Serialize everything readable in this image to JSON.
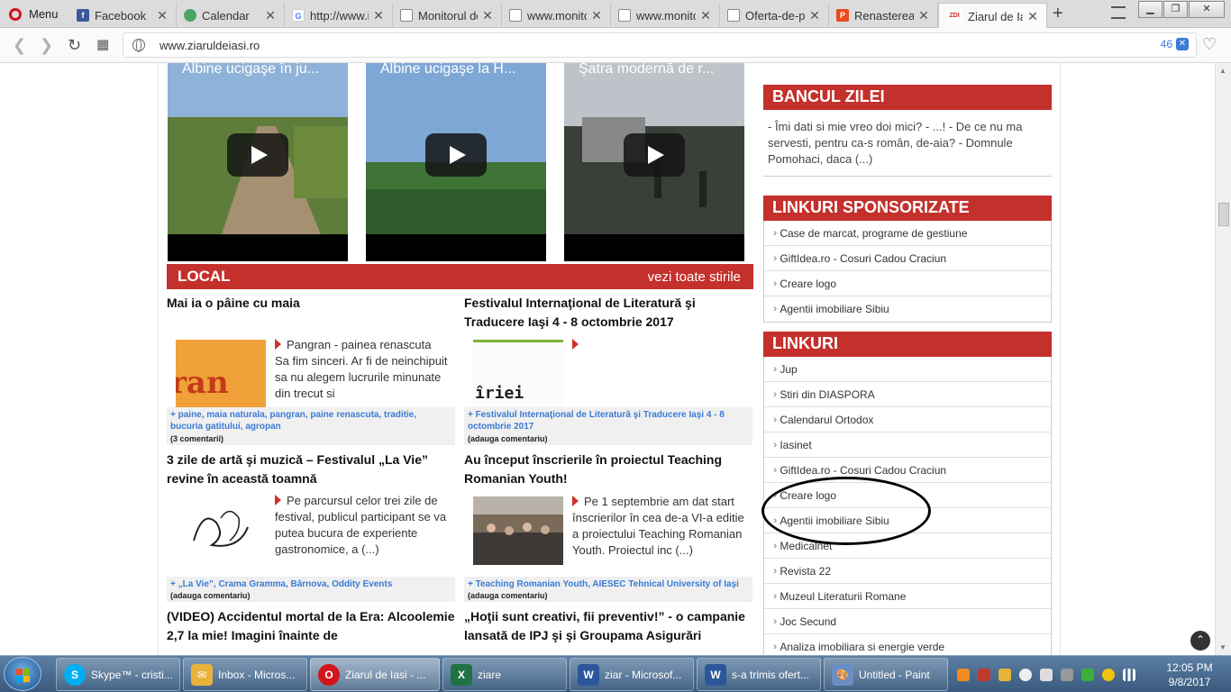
{
  "browser": {
    "menu_label": "Menu",
    "tabs": [
      {
        "label": "Facebook",
        "favicon_color": "#3b5998",
        "favicon_glyph": "f"
      },
      {
        "label": "Calendar",
        "favicon_color": "#4aa564",
        "favicon_glyph": ""
      },
      {
        "label": "http://www.i",
        "favicon_color": "#ffffff",
        "favicon_glyph": "G"
      },
      {
        "label": "Monitorul de",
        "favicon_color": "#9a9a9a",
        "favicon_glyph": ""
      },
      {
        "label": "www.monito",
        "favicon_color": "#9a9a9a",
        "favicon_glyph": ""
      },
      {
        "label": "www.monito",
        "favicon_color": "#9a9a9a",
        "favicon_glyph": ""
      },
      {
        "label": "Oferta-de-p",
        "favicon_color": "#9a9a9a",
        "favicon_glyph": ""
      },
      {
        "label": "Renasterea b",
        "favicon_color": "#e8491d",
        "favicon_glyph": "P"
      },
      {
        "label": "Ziarul de Ias",
        "favicon_color": "#ffffff",
        "favicon_glyph": "ZDI",
        "active": true
      }
    ],
    "new_tab": "+",
    "url": "www.ziaruldeiasi.ro",
    "blocked_count": "46"
  },
  "videos": [
    {
      "title": "Albine ucigaşe în ju..."
    },
    {
      "title": "Albine ucigaşe la H..."
    },
    {
      "title": "Şatra modernă de r..."
    }
  ],
  "local": {
    "title": "LOCAL",
    "more": "vezi toate stirile"
  },
  "articles": [
    {
      "title": "Mai ia o pâine cu maia",
      "excerpt": "Pangran - painea renascuta Sa fim sinceri. Ar fi de neinchipuit sa nu alegem lucrurile minunate din trecut si",
      "tags": "+ paine, maia naturala, pangran, paine renascuta, traditie, bucuria gatitului, agropan",
      "comments": "(3 comentarii)"
    },
    {
      "title": "Festivalul Internaţional de Literatură şi Traducere Iaşi 4 - 8 octombrie 2017",
      "excerpt": "",
      "tags": "+ Festivalul Internaţional de Literatură şi Traducere Iaşi 4 - 8 octombrie 2017",
      "comments": "(adauga comentariu)"
    },
    {
      "title": "3 zile de artă şi muzică – Festivalul „La Vie” revine în această toamnă",
      "excerpt": "Pe parcursul celor trei zile de festival, publicul participant se va putea bucura de experiente gastronomice, a (...)",
      "tags": "+ „La Vie”, Crama Gramma, Bârnova, Oddity Events",
      "comments": "(adauga comentariu)"
    },
    {
      "title": "Au început înscrierile în proiectul Teaching Romanian Youth!",
      "excerpt": "Pe 1 septembrie am dat start înscrierilor în cea de-a VI-a editie a proiectului Teaching Romanian Youth. Proiectul inc (...)",
      "tags": "+ Teaching Romanian Youth, AIESEC Tehnical University of Iaşi",
      "comments": "(adauga comentariu)"
    },
    {
      "title": "(VIDEO) Accidentul mortal de la Era: Alcoolemie 2,7 la mie! Imagini înainte de",
      "excerpt": "",
      "tags": "",
      "comments": ""
    },
    {
      "title": "„Hoţii sunt creativi, fii preventiv!” - o campanie lansată de IPJ şi şi Groupama Asigurări",
      "excerpt": "",
      "tags": "",
      "comments": ""
    }
  ],
  "image_text": {
    "pangran": "ran",
    "festival": "îriei"
  },
  "sidebar": {
    "joke_title": "BANCUL ZILEI",
    "joke_text": "- Îmi dati si mie vreo doi mici? - ...! - De ce nu ma servesti, pentru ca-s român, de-aia? - Domnule Pomohaci, daca (...)",
    "sponsored_title": "LINKURI SPONSORIZATE",
    "sponsored": [
      "Case de marcat, programe de gestiune",
      "GiftIdea.ro - Cosuri Cadou Craciun",
      "Creare logo",
      "Agentii imobiliare Sibiu"
    ],
    "links_title": "LINKURI",
    "links": [
      "Jup",
      "Stiri din DIASPORA",
      "Calendarul Ortodox",
      "Iasinet",
      "GiftIdea.ro - Cosuri Cadou Craciun",
      "Creare logo",
      "Agentii imobiliare Sibiu",
      "Medicalnet",
      "Revista 22",
      "Muzeul Literaturii Romane",
      "Joc Secund",
      "Analiza imobiliara si energie verde"
    ]
  },
  "taskbar": {
    "items": [
      {
        "label": "Skype™ - cristi...",
        "icon_color": "#00aff0",
        "icon_glyph": "S"
      },
      {
        "label": "Inbox - Micros...",
        "icon_color": "#e8b339",
        "icon_glyph": "✉"
      },
      {
        "label": "Ziarul de Iasi - ...",
        "icon_color": "#d2141c",
        "icon_glyph": "O",
        "active": true
      },
      {
        "label": "ziare",
        "icon_color": "#1f7244",
        "icon_glyph": "X"
      },
      {
        "label": "ziar - Microsof...",
        "icon_color": "#2b579a",
        "icon_glyph": "W"
      },
      {
        "label": "s-a trimis ofert...",
        "icon_color": "#2b579a",
        "icon_glyph": "W"
      },
      {
        "label": "Untitled - Paint",
        "icon_color": "#6a8ec4",
        "icon_glyph": "🎨"
      }
    ],
    "time": "12:05 PM",
    "date": "9/8/2017"
  }
}
